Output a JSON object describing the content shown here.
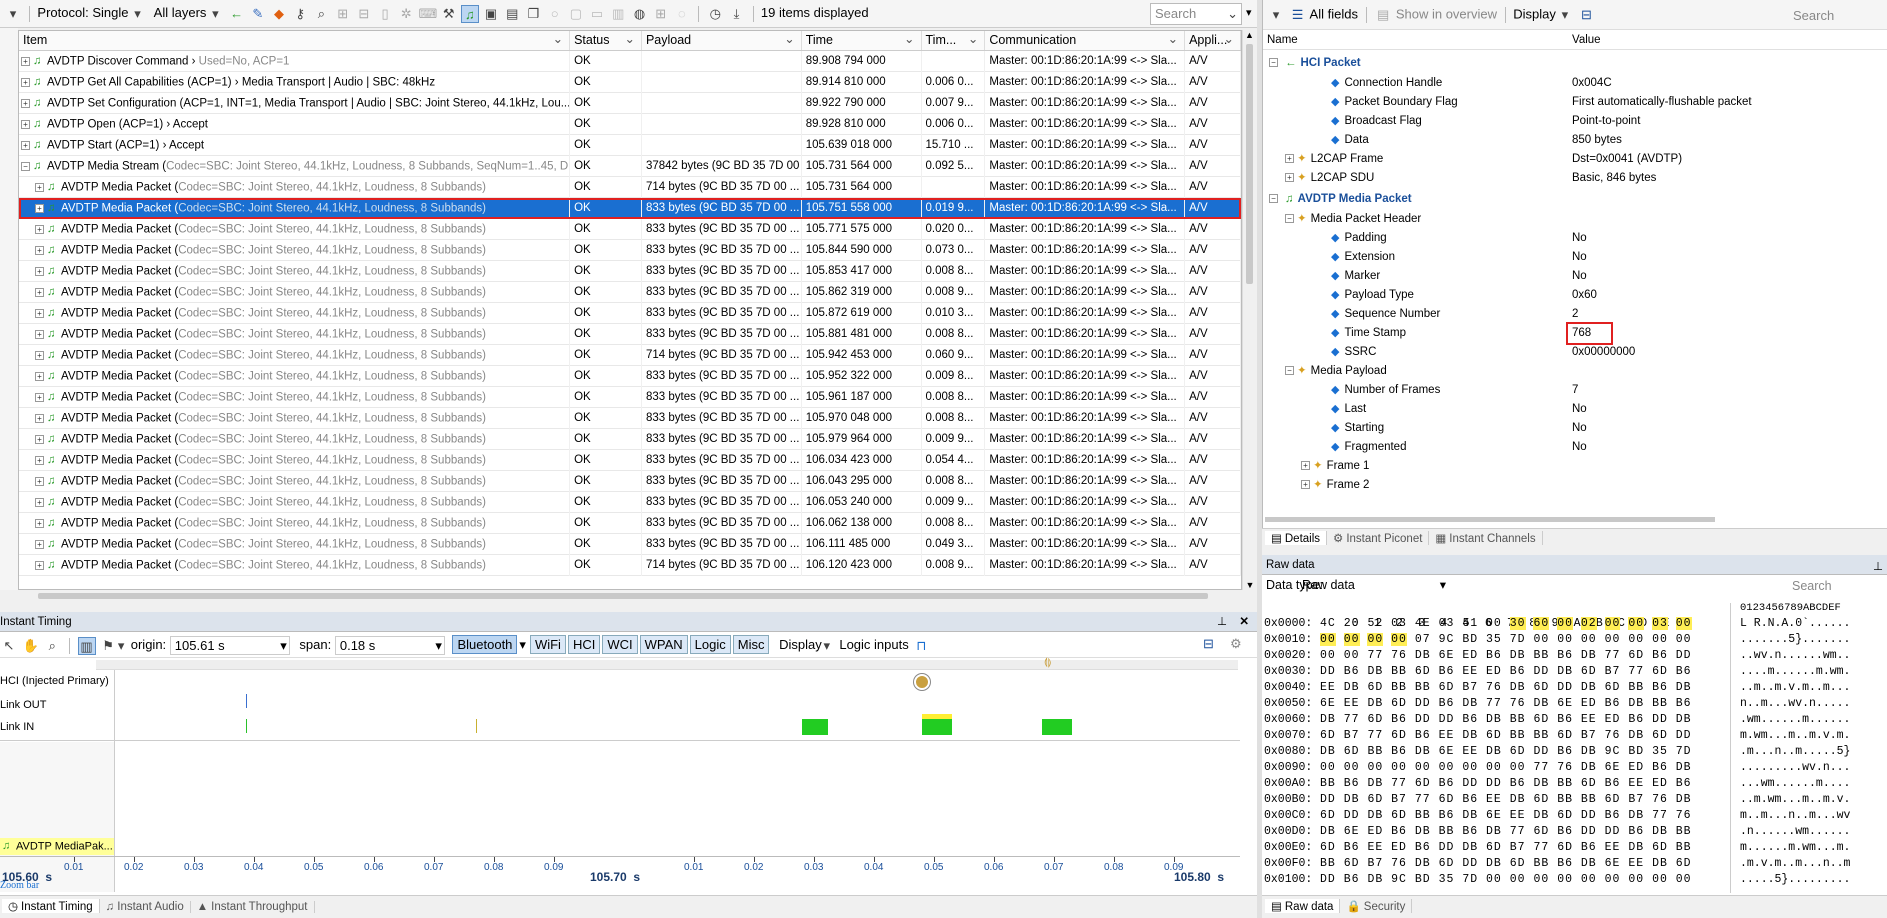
{
  "toolbar": {
    "protocol": "Protocol: Single",
    "layers": "All layers",
    "items_displayed": "19 items displayed",
    "search_placeholder": "Search"
  },
  "packet_list": {
    "columns": [
      "Item",
      "Status",
      "Payload",
      "Time",
      "Tim...",
      "Communication",
      "Appli..."
    ],
    "rows": [
      {
        "item": "AVDTP Discover Command ›",
        "detail": " Used=No, ACP=1",
        "status": "OK",
        "payload": "",
        "time": "89.908 794 000",
        "delta": "",
        "comm": "Master: 00:1D:86:20:1A:99 <-> Sla...",
        "app": "A/V",
        "indent": 0
      },
      {
        "item": "AVDTP Get All Capabilities (ACP=1) › Media Transport | Audio | SBC: 48kHz",
        "detail": "",
        "status": "OK",
        "payload": "",
        "time": "89.914 810 000",
        "delta": "0.006 0...",
        "comm": "Master: 00:1D:86:20:1A:99 <-> Sla...",
        "app": "A/V",
        "indent": 0
      },
      {
        "item": "AVDTP Set Configuration (ACP=1, INT=1, Media Transport | Audio | SBC: Joint Stereo, 44.1kHz, Lou...",
        "detail": "",
        "status": "OK",
        "payload": "",
        "time": "89.922 790 000",
        "delta": "0.007 9...",
        "comm": "Master: 00:1D:86:20:1A:99 <-> Sla...",
        "app": "A/V",
        "indent": 0
      },
      {
        "item": "AVDTP Open (ACP=1) › Accept",
        "detail": "",
        "status": "OK",
        "payload": "",
        "time": "89.928 810 000",
        "delta": "0.006 0...",
        "comm": "Master: 00:1D:86:20:1A:99 <-> Sla...",
        "app": "A/V",
        "indent": 0
      },
      {
        "item": "AVDTP Start (ACP=1) › Accept",
        "detail": "",
        "status": "OK",
        "payload": "",
        "time": "105.639 018 000",
        "delta": "15.710 ...",
        "comm": "Master: 00:1D:86:20:1A:99 <-> Sla...",
        "app": "A/V",
        "indent": 0
      },
      {
        "item": "AVDTP Media Stream (",
        "detail": "Codec=SBC: Joint Stereo, 44.1kHz, Loudness, 8 Subbands, SeqNum=1..45, D...",
        "status": "OK",
        "payload": "37842 bytes (9C BD 35 7D 00 ...",
        "time": "105.731 564 000",
        "delta": "0.092 5...",
        "comm": "Master: 00:1D:86:20:1A:99 <-> Sla...",
        "app": "A/V",
        "indent": 0
      },
      {
        "item": "AVDTP Media Packet (",
        "detail": "Codec=SBC: Joint Stereo, 44.1kHz, Loudness, 8 Subbands)",
        "status": "OK",
        "payload": "714 bytes (9C BD 35 7D 00 ...",
        "time": "105.731 564 000",
        "delta": "",
        "comm": "Master: 00:1D:86:20:1A:99 <-> Sla...",
        "app": "A/V",
        "indent": 1
      },
      {
        "item": "AVDTP Media Packet (",
        "detail": "Codec=SBC: Joint Stereo, 44.1kHz, Loudness, 8 Subbands)",
        "status": "OK",
        "payload": "833 bytes (9C BD 35 7D 00 ...",
        "time": "105.751 558 000",
        "delta": "0.019 9...",
        "comm": "Master: 00:1D:86:20:1A:99 <-> Sla...",
        "app": "A/V",
        "indent": 1,
        "selected": true
      },
      {
        "item": "AVDTP Media Packet (",
        "detail": "Codec=SBC: Joint Stereo, 44.1kHz, Loudness, 8 Subbands)",
        "status": "OK",
        "payload": "833 bytes (9C BD 35 7D 00 ...",
        "time": "105.771 575 000",
        "delta": "0.020 0...",
        "comm": "Master: 00:1D:86:20:1A:99 <-> Sla...",
        "app": "A/V",
        "indent": 1
      },
      {
        "item": "AVDTP Media Packet (",
        "detail": "Codec=SBC: Joint Stereo, 44.1kHz, Loudness, 8 Subbands)",
        "status": "OK",
        "payload": "833 bytes (9C BD 35 7D 00 ...",
        "time": "105.844 590 000",
        "delta": "0.073 0...",
        "comm": "Master: 00:1D:86:20:1A:99 <-> Sla...",
        "app": "A/V",
        "indent": 1
      },
      {
        "item": "AVDTP Media Packet (",
        "detail": "Codec=SBC: Joint Stereo, 44.1kHz, Loudness, 8 Subbands)",
        "status": "OK",
        "payload": "833 bytes (9C BD 35 7D 00 ...",
        "time": "105.853 417 000",
        "delta": "0.008 8...",
        "comm": "Master: 00:1D:86:20:1A:99 <-> Sla...",
        "app": "A/V",
        "indent": 1
      },
      {
        "item": "AVDTP Media Packet (",
        "detail": "Codec=SBC: Joint Stereo, 44.1kHz, Loudness, 8 Subbands)",
        "status": "OK",
        "payload": "833 bytes (9C BD 35 7D 00 ...",
        "time": "105.862 319 000",
        "delta": "0.008 9...",
        "comm": "Master: 00:1D:86:20:1A:99 <-> Sla...",
        "app": "A/V",
        "indent": 1
      },
      {
        "item": "AVDTP Media Packet (",
        "detail": "Codec=SBC: Joint Stereo, 44.1kHz, Loudness, 8 Subbands)",
        "status": "OK",
        "payload": "833 bytes (9C BD 35 7D 00 ...",
        "time": "105.872 619 000",
        "delta": "0.010 3...",
        "comm": "Master: 00:1D:86:20:1A:99 <-> Sla...",
        "app": "A/V",
        "indent": 1
      },
      {
        "item": "AVDTP Media Packet (",
        "detail": "Codec=SBC: Joint Stereo, 44.1kHz, Loudness, 8 Subbands)",
        "status": "OK",
        "payload": "833 bytes (9C BD 35 7D 00 ...",
        "time": "105.881 481 000",
        "delta": "0.008 8...",
        "comm": "Master: 00:1D:86:20:1A:99 <-> Sla...",
        "app": "A/V",
        "indent": 1
      },
      {
        "item": "AVDTP Media Packet (",
        "detail": "Codec=SBC: Joint Stereo, 44.1kHz, Loudness, 8 Subbands)",
        "status": "OK",
        "payload": "714 bytes (9C BD 35 7D 00 ...",
        "time": "105.942 453 000",
        "delta": "0.060 9...",
        "comm": "Master: 00:1D:86:20:1A:99 <-> Sla...",
        "app": "A/V",
        "indent": 1
      },
      {
        "item": "AVDTP Media Packet (",
        "detail": "Codec=SBC: Joint Stereo, 44.1kHz, Loudness, 8 Subbands)",
        "status": "OK",
        "payload": "833 bytes (9C BD 35 7D 00 ...",
        "time": "105.952 322 000",
        "delta": "0.009 8...",
        "comm": "Master: 00:1D:86:20:1A:99 <-> Sla...",
        "app": "A/V",
        "indent": 1
      },
      {
        "item": "AVDTP Media Packet (",
        "detail": "Codec=SBC: Joint Stereo, 44.1kHz, Loudness, 8 Subbands)",
        "status": "OK",
        "payload": "833 bytes (9C BD 35 7D 00 ...",
        "time": "105.961 187 000",
        "delta": "0.008 8...",
        "comm": "Master: 00:1D:86:20:1A:99 <-> Sla...",
        "app": "A/V",
        "indent": 1
      },
      {
        "item": "AVDTP Media Packet (",
        "detail": "Codec=SBC: Joint Stereo, 44.1kHz, Loudness, 8 Subbands)",
        "status": "OK",
        "payload": "833 bytes (9C BD 35 7D 00 ...",
        "time": "105.970 048 000",
        "delta": "0.008 8...",
        "comm": "Master: 00:1D:86:20:1A:99 <-> Sla...",
        "app": "A/V",
        "indent": 1
      },
      {
        "item": "AVDTP Media Packet (",
        "detail": "Codec=SBC: Joint Stereo, 44.1kHz, Loudness, 8 Subbands)",
        "status": "OK",
        "payload": "833 bytes (9C BD 35 7D 00 ...",
        "time": "105.979 964 000",
        "delta": "0.009 9...",
        "comm": "Master: 00:1D:86:20:1A:99 <-> Sla...",
        "app": "A/V",
        "indent": 1
      },
      {
        "item": "AVDTP Media Packet (",
        "detail": "Codec=SBC: Joint Stereo, 44.1kHz, Loudness, 8 Subbands)",
        "status": "OK",
        "payload": "833 bytes (9C BD 35 7D 00 ...",
        "time": "106.034 423 000",
        "delta": "0.054 4...",
        "comm": "Master: 00:1D:86:20:1A:99 <-> Sla...",
        "app": "A/V",
        "indent": 1
      },
      {
        "item": "AVDTP Media Packet (",
        "detail": "Codec=SBC: Joint Stereo, 44.1kHz, Loudness, 8 Subbands)",
        "status": "OK",
        "payload": "833 bytes (9C BD 35 7D 00 ...",
        "time": "106.043 295 000",
        "delta": "0.008 8...",
        "comm": "Master: 00:1D:86:20:1A:99 <-> Sla...",
        "app": "A/V",
        "indent": 1
      },
      {
        "item": "AVDTP Media Packet (",
        "detail": "Codec=SBC: Joint Stereo, 44.1kHz, Loudness, 8 Subbands)",
        "status": "OK",
        "payload": "833 bytes (9C BD 35 7D 00 ...",
        "time": "106.053 240 000",
        "delta": "0.009 9...",
        "comm": "Master: 00:1D:86:20:1A:99 <-> Sla...",
        "app": "A/V",
        "indent": 1
      },
      {
        "item": "AVDTP Media Packet (",
        "detail": "Codec=SBC: Joint Stereo, 44.1kHz, Loudness, 8 Subbands)",
        "status": "OK",
        "payload": "833 bytes (9C BD 35 7D 00 ...",
        "time": "106.062 138 000",
        "delta": "0.008 8...",
        "comm": "Master: 00:1D:86:20:1A:99 <-> Sla...",
        "app": "A/V",
        "indent": 1
      },
      {
        "item": "AVDTP Media Packet (",
        "detail": "Codec=SBC: Joint Stereo, 44.1kHz, Loudness, 8 Subbands)",
        "status": "OK",
        "payload": "833 bytes (9C BD 35 7D 00 ...",
        "time": "106.111 485 000",
        "delta": "0.049 3...",
        "comm": "Master: 00:1D:86:20:1A:99 <-> Sla...",
        "app": "A/V",
        "indent": 1
      },
      {
        "item": "AVDTP Media Packet (",
        "detail": "Codec=SBC: Joint Stereo, 44.1kHz, Loudness, 8 Subbands)",
        "status": "OK",
        "payload": "714 bytes (9C BD 35 7D 00 ...",
        "time": "106.120 423 000",
        "delta": "0.008 9...",
        "comm": "Master: 00:1D:86:20:1A:99 <-> Sla...",
        "app": "A/V",
        "indent": 1
      }
    ]
  },
  "details": {
    "all_fields": "All fields",
    "show_overview": "Show in overview",
    "display": "Display",
    "search": "Search",
    "col_name": "Name",
    "col_value": "Value",
    "rows": [
      {
        "name": "HCI Packet",
        "value": "",
        "level": 0,
        "type": "section"
      },
      {
        "name": "Connection Handle",
        "value": "0x004C",
        "level": 2
      },
      {
        "name": "Packet Boundary Flag",
        "value": "First automatically-flushable packet",
        "level": 2
      },
      {
        "name": "Broadcast Flag",
        "value": "Point-to-point",
        "level": 2
      },
      {
        "name": "Data",
        "value": "850 bytes",
        "level": 2
      },
      {
        "name": "L2CAP Frame",
        "value": "Dst=0x0041 (AVDTP)",
        "level": 1,
        "type": "collapsed"
      },
      {
        "name": "L2CAP SDU",
        "value": "Basic, 846 bytes",
        "level": 1,
        "type": "collapsed"
      },
      {
        "name": "AVDTP Media Packet",
        "value": "",
        "level": 0,
        "type": "section"
      },
      {
        "name": "Media Packet Header",
        "value": "",
        "level": 1,
        "type": "group"
      },
      {
        "name": "Padding",
        "value": "No",
        "level": 2
      },
      {
        "name": "Extension",
        "value": "No",
        "level": 2
      },
      {
        "name": "Marker",
        "value": "No",
        "level": 2
      },
      {
        "name": "Payload Type",
        "value": "0x60",
        "level": 2
      },
      {
        "name": "Sequence Number",
        "value": "2",
        "level": 2
      },
      {
        "name": "Time Stamp",
        "value": "768",
        "level": 2,
        "highlight": true
      },
      {
        "name": "SSRC",
        "value": "0x00000000",
        "level": 2
      },
      {
        "name": "Media Payload",
        "value": "",
        "level": 1,
        "type": "group"
      },
      {
        "name": "Number of Frames",
        "value": "7",
        "level": 2
      },
      {
        "name": "Last",
        "value": "No",
        "level": 2
      },
      {
        "name": "Starting",
        "value": "No",
        "level": 2
      },
      {
        "name": "Fragmented",
        "value": "No",
        "level": 2
      },
      {
        "name": "Frame 1",
        "value": "",
        "level": 2,
        "type": "collapsed"
      },
      {
        "name": "Frame 2",
        "value": "",
        "level": 2,
        "type": "collapsed"
      }
    ],
    "tabs": [
      "Details",
      "Instant Piconet",
      "Instant Channels"
    ]
  },
  "raw": {
    "title": "Raw data",
    "data_type_label": "Data type:",
    "data_type": "Raw data",
    "search": "Search",
    "hex_header": "0 1 2 3 4 5 6 7 8 9 A B C D E F",
    "ascii_header": "0123456789ABCDEF",
    "rows": [
      {
        "addr": "0x0000:",
        "hex": "4C 20 52 03 4E 03 41 00 30 60 00 02 00 00 03 00",
        "ascii": "L R.N.A.0`......"
      },
      {
        "addr": "0x0010:",
        "hex": "00 00 00 00 07 9C BD 35 7D 00 00 00 00 00 00 00",
        "ascii": ".......5}......."
      },
      {
        "addr": "0x0020:",
        "hex": "00 00 77 76 DB 6E ED B6 DB BB B6 DB 77 6D B6 DD",
        "ascii": "..wv.n......wm.."
      },
      {
        "addr": "0x0030:",
        "hex": "DD B6 DB BB 6D B6 EE ED B6 DD DB 6D B7 77 6D B6",
        "ascii": "....m......m.wm."
      },
      {
        "addr": "0x0040:",
        "hex": "EE DB 6D BB BB 6D B7 76 DB 6D DD DB 6D BB B6 DB",
        "ascii": "..m..m.v.m..m..."
      },
      {
        "addr": "0x0050:",
        "hex": "6E EE DB 6D DD B6 DB 77 76 DB 6E ED B6 DB BB B6",
        "ascii": "n..m...wv.n....."
      },
      {
        "addr": "0x0060:",
        "hex": "DB 77 6D B6 DD DD B6 DB BB 6D B6 EE ED B6 DD DB",
        "ascii": ".wm......m......"
      },
      {
        "addr": "0x0070:",
        "hex": "6D B7 77 6D B6 EE DB 6D BB BB 6D B7 76 DB 6D DD",
        "ascii": "m.wm...m..m.v.m."
      },
      {
        "addr": "0x0080:",
        "hex": "DB 6D BB B6 DB 6E EE DB 6D DD B6 DB 9C BD 35 7D",
        "ascii": ".m...n..m.....5}"
      },
      {
        "addr": "0x0090:",
        "hex": "00 00 00 00 00 00 00 00 00 77 76 DB 6E ED B6 DB",
        "ascii": ".........wv.n..."
      },
      {
        "addr": "0x00A0:",
        "hex": "BB B6 DB 77 6D B6 DD DD B6 DB BB 6D B6 EE ED B6",
        "ascii": "...wm......m...."
      },
      {
        "addr": "0x00B0:",
        "hex": "DD DB 6D B7 77 6D B6 EE DB 6D BB BB 6D B7 76 DB",
        "ascii": "..m.wm...m..m.v."
      },
      {
        "addr": "0x00C0:",
        "hex": "6D DD DB 6D BB B6 DB 6E EE DB 6D DD B6 DB 77 76",
        "ascii": "m..m...n..m...wv"
      },
      {
        "addr": "0x00D0:",
        "hex": "DB 6E ED B6 DB BB B6 DB 77 6D B6 DD DD B6 DB BB",
        "ascii": ".n......wm......"
      },
      {
        "addr": "0x00E0:",
        "hex": "6D B6 EE ED B6 DD DB 6D B7 77 6D B6 EE DB 6D BB",
        "ascii": "m......m.wm...m."
      },
      {
        "addr": "0x00F0:",
        "hex": "BB 6D B7 76 DB 6D DD DB 6D BB B6 DB 6E EE DB 6D",
        "ascii": ".m.v.m..m...n..m"
      },
      {
        "addr": "0x0100:",
        "hex": "DD B6 DB 9C BD 35 7D 00 00 00 00 00 00 00 00 00",
        "ascii": ".....5}........."
      }
    ],
    "tabs": [
      "Raw data",
      "Security"
    ]
  },
  "timing": {
    "title": "Instant Timing",
    "origin_label": "origin:",
    "origin": "105.61 s",
    "span_label": "span:",
    "span": "0.18 s",
    "filters": [
      "Bluetooth",
      "WiFi",
      "HCI",
      "WCI",
      "WPAN",
      "Logic",
      "Misc"
    ],
    "display": "Display",
    "logic_inputs": "Logic inputs",
    "lanes": [
      "HCI (Injected Primary)",
      "Link OUT",
      "Link IN"
    ],
    "track_label": "AVDTP MediaPak...",
    "axis_left": "105.60  s",
    "axis_mid": "105.70  s",
    "axis_right": "105.80  s",
    "ticks": [
      "0.01",
      "0.02",
      "0.03",
      "0.04",
      "0.05",
      "0.06",
      "0.07",
      "0.08",
      "0.09",
      "0.01",
      "0.02",
      "0.03",
      "0.04",
      "0.05",
      "0.06",
      "0.07",
      "0.08",
      "0.09"
    ],
    "zoom_bar": "Zoom bar",
    "tabs": [
      "Instant Timing",
      "Instant Audio",
      "Instant Throughput"
    ]
  }
}
